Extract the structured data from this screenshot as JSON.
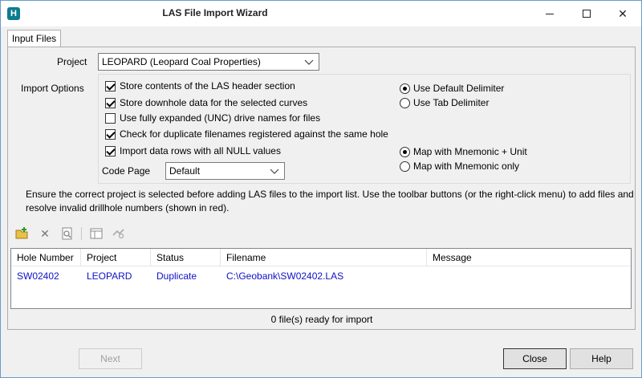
{
  "window": {
    "title": "LAS File Import Wizard",
    "app_icon": "H"
  },
  "tabs": [
    {
      "label": "Input Files"
    }
  ],
  "project": {
    "label": "Project",
    "value": "LEOPARD (Leopard Coal Properties)"
  },
  "import_options": {
    "label": "Import Options",
    "checkboxes": [
      {
        "label": "Store contents of the LAS header section",
        "checked": true
      },
      {
        "label": "Store downhole data for the selected curves",
        "checked": true
      },
      {
        "label": "Use fully expanded (UNC) drive names for files",
        "checked": false
      },
      {
        "label": "Check for duplicate filenames registered against the same hole",
        "checked": true
      },
      {
        "label": "Import  data rows with all NULL values",
        "checked": true
      }
    ],
    "delimiter_radios": [
      {
        "label": "Use Default Delimiter",
        "selected": true
      },
      {
        "label": "Use Tab Delimiter",
        "selected": false
      }
    ],
    "mapping_radios": [
      {
        "label": "Map with Mnemonic + Unit",
        "selected": true
      },
      {
        "label": "Map with Mnemonic only",
        "selected": false
      }
    ],
    "code_page": {
      "label": "Code Page",
      "value": "Default"
    }
  },
  "info_text": "Ensure the correct project is selected before adding LAS files to the import list. Use the toolbar buttons (or the right-click menu)  to add files and resolve invalid drillhole numbers  (shown in red).",
  "toolbar": [
    "add-files-icon",
    "delete-icon",
    "find-icon",
    "columns-icon",
    "resolve-icon"
  ],
  "grid": {
    "columns": [
      "Hole Number",
      "Project",
      "Status",
      "Filename",
      "Message"
    ],
    "rows": [
      [
        "SW02402",
        "LEOPARD",
        "Duplicate",
        "C:\\Geobank\\SW02402.LAS",
        ""
      ]
    ],
    "row_color": "#1010c8"
  },
  "status_text": "0 file(s) ready for import",
  "buttons": {
    "next": "Next",
    "close": "Close",
    "help": "Help"
  }
}
